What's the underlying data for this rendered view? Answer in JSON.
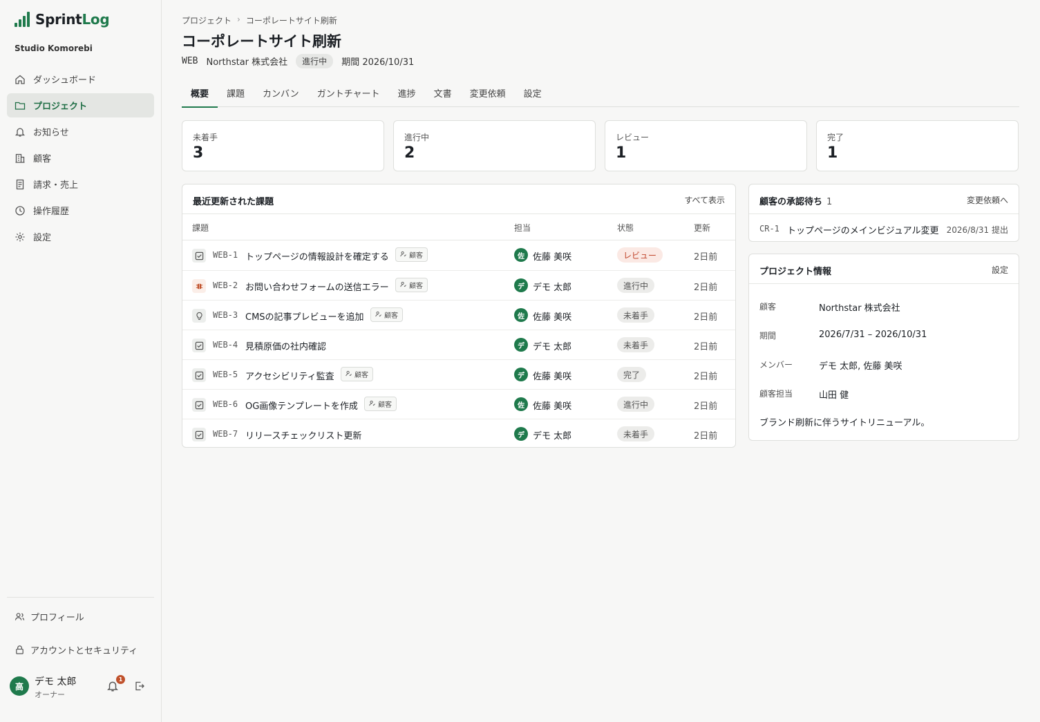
{
  "brand": {
    "name_a": "Sprint",
    "name_b": "Log"
  },
  "org": "Studio Komorebi",
  "nav": [
    {
      "label": "ダッシュボード",
      "icon": "home-icon"
    },
    {
      "label": "プロジェクト",
      "icon": "folder-icon"
    },
    {
      "label": "お知らせ",
      "icon": "bell-icon"
    },
    {
      "label": "顧客",
      "icon": "building-icon"
    },
    {
      "label": "請求・売上",
      "icon": "receipt-icon"
    },
    {
      "label": "操作履歴",
      "icon": "clock-icon"
    },
    {
      "label": "設定",
      "icon": "gear-icon"
    }
  ],
  "side_links": {
    "profile": "プロフィール",
    "security": "アカウントとセキュリティ"
  },
  "user": {
    "initial": "高",
    "name": "デモ 太郎",
    "role": "オーナー",
    "notifications": "1"
  },
  "breadcrumb": {
    "parent": "プロジェクト",
    "sep": "›",
    "current": "コーポレートサイト刷新"
  },
  "project": {
    "title": "コーポレートサイト刷新",
    "key": "WEB",
    "client": "Northstar 株式会社",
    "status": "進行中",
    "deadline": "期間 2026/10/31"
  },
  "tabs": [
    "概要",
    "課題",
    "カンバン",
    "ガントチャート",
    "進捗",
    "文書",
    "変更依頼",
    "設定"
  ],
  "stats": [
    {
      "label": "未着手",
      "value": "3"
    },
    {
      "label": "進行中",
      "value": "2"
    },
    {
      "label": "レビュー",
      "value": "1"
    },
    {
      "label": "完了",
      "value": "1"
    }
  ],
  "issues": {
    "title": "最近更新された課題",
    "view_all": "すべて表示",
    "columns": {
      "issue": "課題",
      "assignee": "担当",
      "status": "状態",
      "updated": "更新"
    },
    "client_tag": "顧客",
    "rows": [
      {
        "type": "task",
        "key": "WEB-1",
        "title": "トップページの情報設計を確定する",
        "client": true,
        "assignee_initial": "佐",
        "assignee": "佐藤 美咲",
        "status": "レビュー",
        "status_kind": "review",
        "updated": "2日前"
      },
      {
        "type": "bug",
        "key": "WEB-2",
        "title": "お問い合わせフォームの送信エラー",
        "client": true,
        "assignee_initial": "デ",
        "assignee": "デモ 太郎",
        "status": "進行中",
        "status_kind": "normal",
        "updated": "2日前"
      },
      {
        "type": "idea",
        "key": "WEB-3",
        "title": "CMSの記事プレビューを追加",
        "client": true,
        "assignee_initial": "佐",
        "assignee": "佐藤 美咲",
        "status": "未着手",
        "status_kind": "normal",
        "updated": "2日前"
      },
      {
        "type": "task",
        "key": "WEB-4",
        "title": "見積原価の社内確認",
        "client": false,
        "assignee_initial": "デ",
        "assignee": "デモ 太郎",
        "status": "未着手",
        "status_kind": "normal",
        "updated": "2日前"
      },
      {
        "type": "task",
        "key": "WEB-5",
        "title": "アクセシビリティ監査",
        "client": true,
        "assignee_initial": "デ",
        "assignee": "佐藤 美咲",
        "status": "完了",
        "status_kind": "normal",
        "updated": "2日前"
      },
      {
        "type": "task",
        "key": "WEB-6",
        "title": "OG画像テンプレートを作成",
        "client": true,
        "assignee_initial": "佐",
        "assignee": "佐藤 美咲",
        "status": "進行中",
        "status_kind": "normal",
        "updated": "2日前"
      },
      {
        "type": "task",
        "key": "WEB-7",
        "title": "リリースチェックリスト更新",
        "client": false,
        "assignee_initial": "デ",
        "assignee": "デモ 太郎",
        "status": "未着手",
        "status_kind": "normal",
        "updated": "2日前"
      }
    ]
  },
  "approval": {
    "title": "顧客の承認待ち",
    "count": "1",
    "link": "変更依頼へ",
    "item": {
      "key": "CR-1",
      "title": "トップページのメインビジュアル変更",
      "date": "2026/8/31 提出"
    }
  },
  "info": {
    "title": "プロジェクト情報",
    "link": "設定",
    "fields": [
      {
        "label": "顧客",
        "value": "Northstar 株式会社"
      },
      {
        "label": "期間",
        "value": "2026/7/31 – 2026/10/31"
      },
      {
        "label": "メンバー",
        "value": "デモ 太郎, 佐藤 美咲"
      },
      {
        "label": "顧客担当",
        "value": "山田 健"
      }
    ],
    "description": "ブランド刷新に伴うサイトリニューアル。"
  },
  "colors": {
    "accent": "#1f7a4c",
    "review_text": "#c0452b",
    "review_bg": "#fbe9e4",
    "sidebar_active_bg": "#e4e6e3"
  }
}
